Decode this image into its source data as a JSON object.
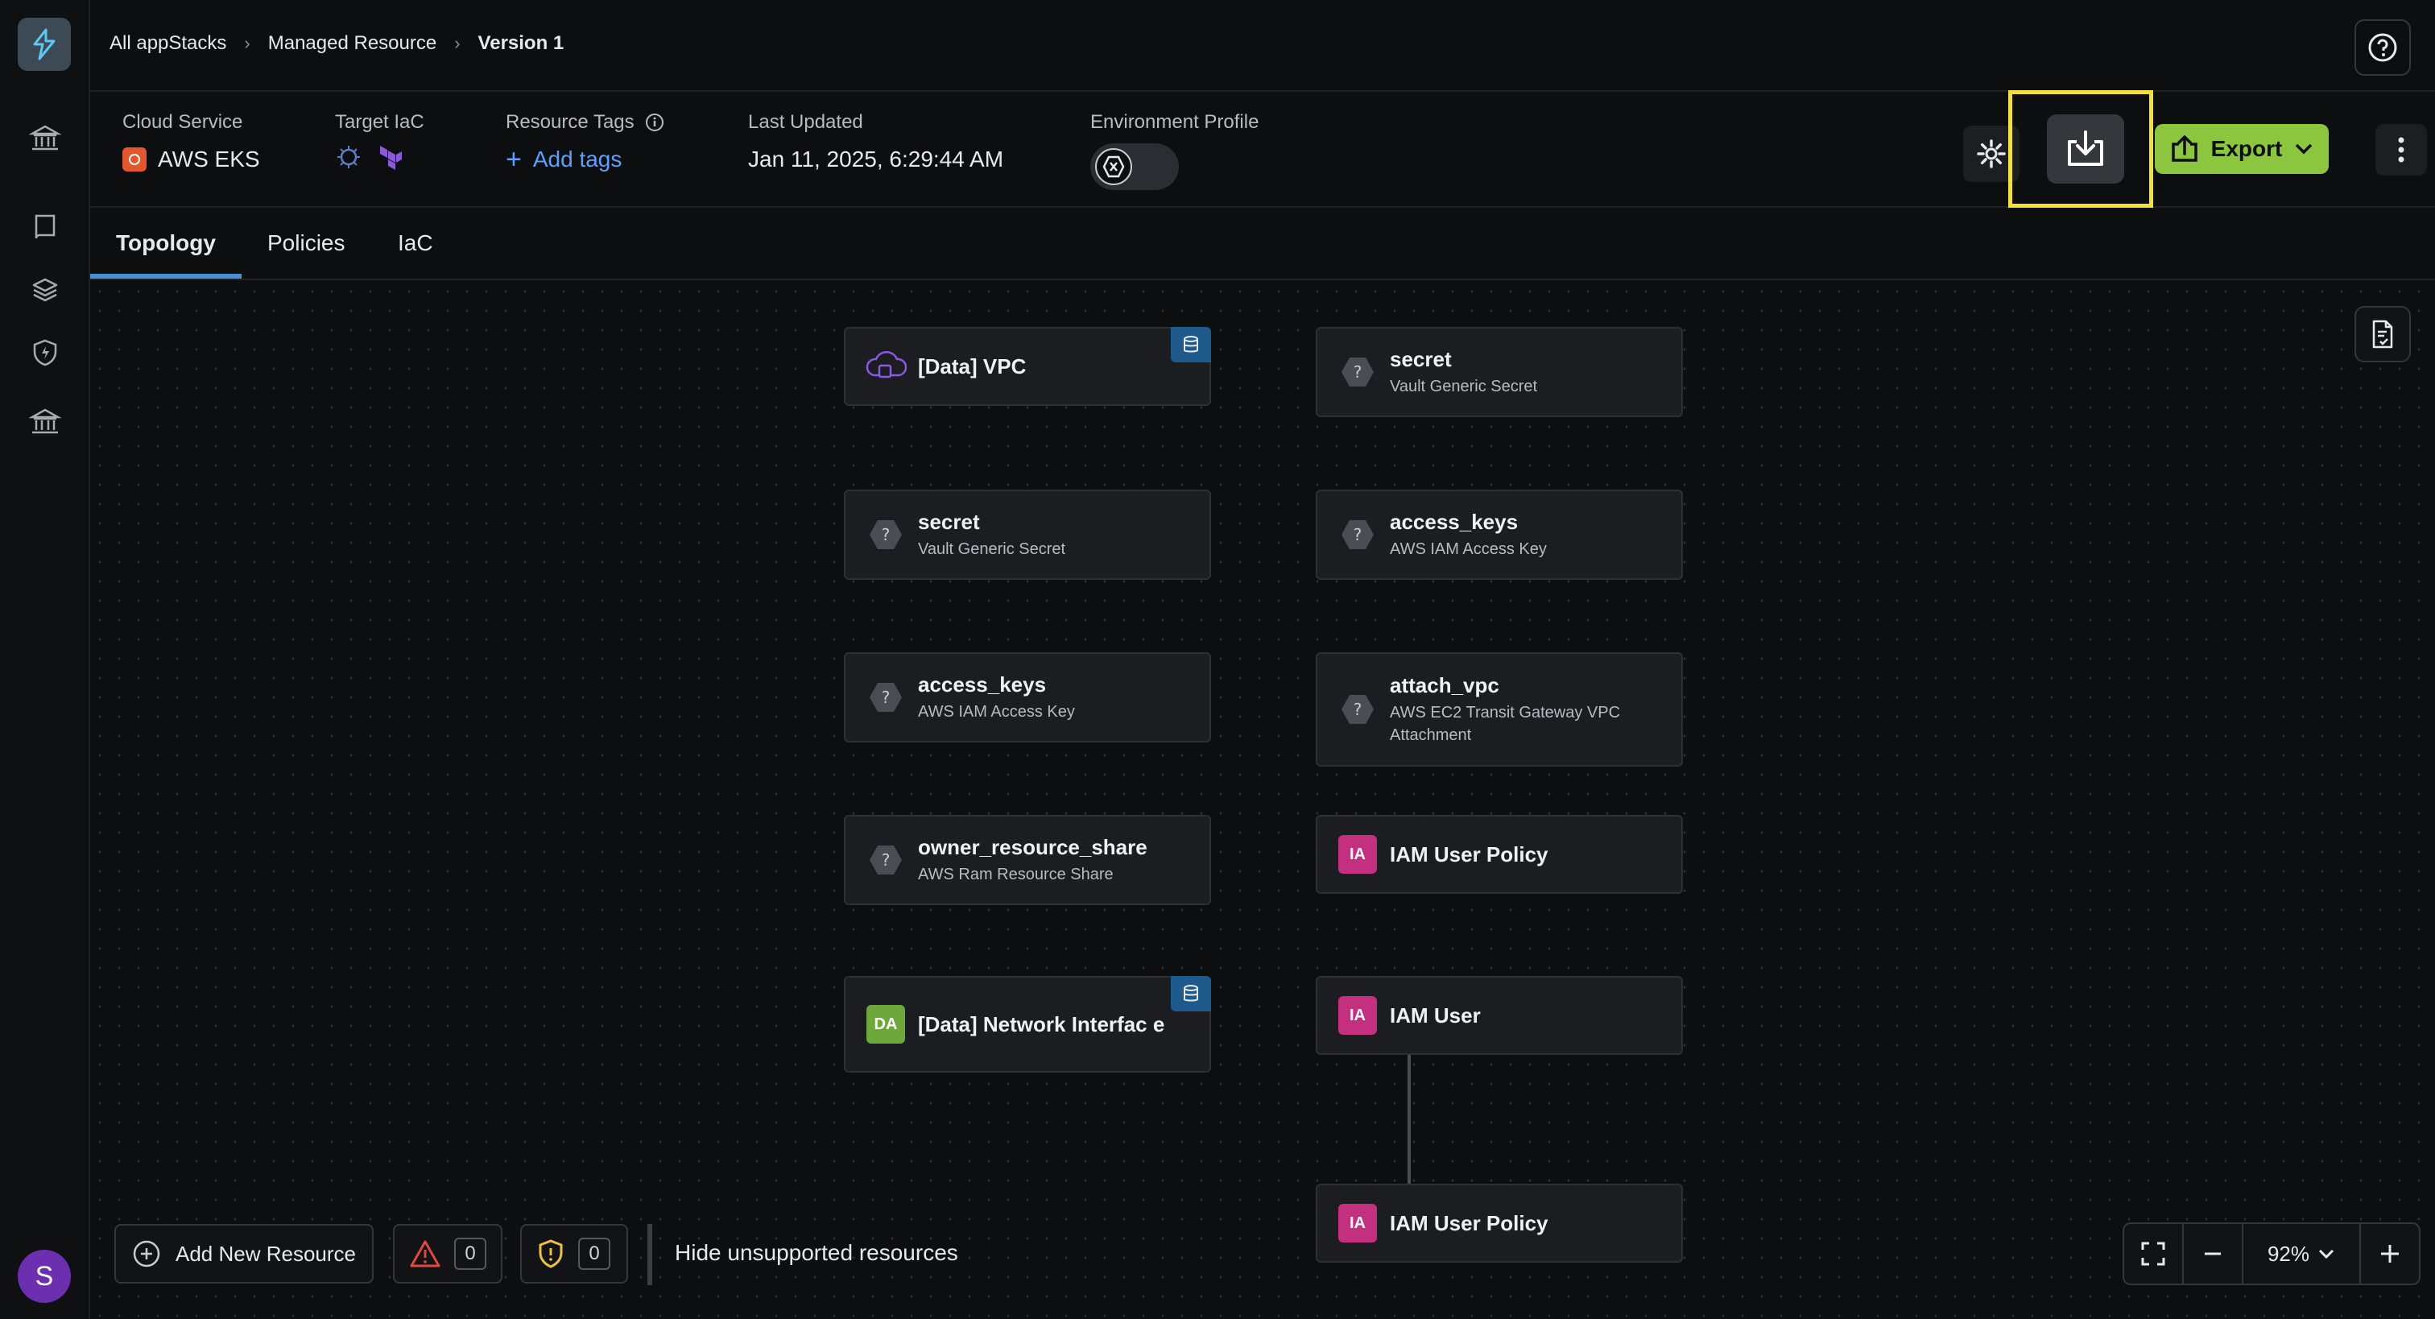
{
  "breadcrumb": {
    "items": [
      "All appStacks",
      "Managed Resource",
      "Version 1"
    ]
  },
  "info": {
    "cloud_service_label": "Cloud Service",
    "cloud_service_value": "AWS EKS",
    "target_iac_label": "Target IaC",
    "resource_tags_label": "Resource Tags",
    "add_tags": "Add tags",
    "last_updated_label": "Last Updated",
    "last_updated_value": "Jan 11, 2025, 6:29:44 AM",
    "env_profile_label": "Environment Profile"
  },
  "actions": {
    "export_label": "Export"
  },
  "tabs": [
    {
      "label": "Topology",
      "active": true
    },
    {
      "label": "Policies",
      "active": false
    },
    {
      "label": "IaC",
      "active": false
    }
  ],
  "nodes": {
    "data_vpc": {
      "name": "[Data] VPC"
    },
    "secret_right": {
      "name": "secret",
      "sub": "Vault Generic Secret"
    },
    "secret_left": {
      "name": "secret",
      "sub": "Vault Generic Secret"
    },
    "access_keys_right": {
      "name": "access_keys",
      "sub": "AWS IAM Access Key"
    },
    "access_keys_left": {
      "name": "access_keys",
      "sub": "AWS IAM Access Key"
    },
    "attach_vpc": {
      "name": "attach_vpc",
      "sub": "AWS EC2 Transit Gateway VPC Attachment"
    },
    "owner_resource_share": {
      "name": "owner_resource_share",
      "sub": "AWS Ram Resource Share"
    },
    "iam_user_policy_1": {
      "name": "IAM User Policy",
      "badge": "IA"
    },
    "data_network_interface": {
      "name": "[Data] Network Interfac e",
      "badge": "DA"
    },
    "iam_user": {
      "name": "IAM User",
      "badge": "IA"
    },
    "iam_user_policy_2": {
      "name": "IAM User Policy",
      "badge": "IA"
    }
  },
  "bottom": {
    "add_new_resource": "Add New Resource",
    "warnings_count": "0",
    "security_count": "0",
    "hide_unsupported": "Hide unsupported resources",
    "zoom_level": "92%"
  },
  "user": {
    "avatar_initial": "S"
  },
  "colors": {
    "accent_green": "#8cc63f",
    "highlight_yellow": "#f3e03a",
    "tab_underline": "#4a8fd8",
    "iam_badge": "#c2307f"
  }
}
